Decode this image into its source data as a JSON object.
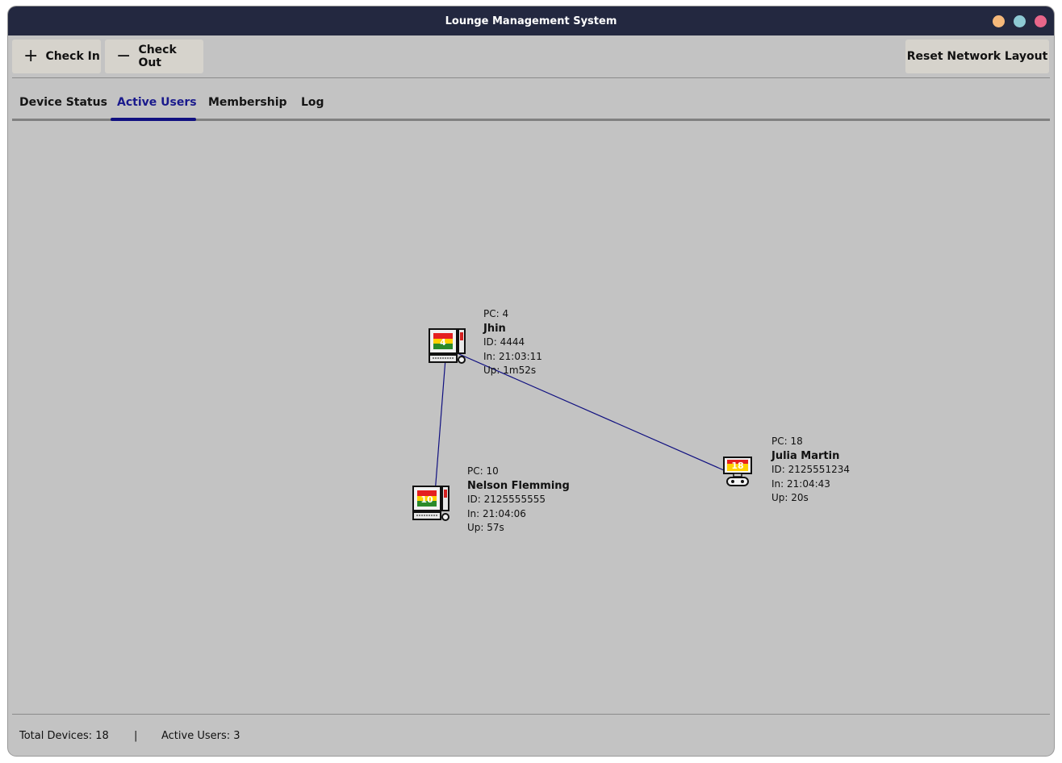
{
  "window": {
    "title": "Lounge Management System"
  },
  "toolbar": {
    "check_in": {
      "icon": "plus-icon",
      "label": "Check In"
    },
    "check_out": {
      "icon": "minus-icon",
      "label": "Check Out"
    },
    "reset_label": "Reset Network Layout"
  },
  "tabs": [
    {
      "label": "Device Status",
      "active": false
    },
    {
      "label": "Active Users",
      "active": true
    },
    {
      "label": "Membership",
      "active": false
    },
    {
      "label": "Log",
      "active": false
    }
  ],
  "accent_color": "#101080",
  "network": {
    "nodes": [
      {
        "pc_label": "PC: 4",
        "pc_number": "4",
        "device": "desktop-pc-icon",
        "name": "Jhin",
        "id_line": "ID: 4444",
        "in_line": "In: 21:03:11",
        "up_line": "Up: 1m52s"
      },
      {
        "pc_label": "PC: 10",
        "pc_number": "10",
        "device": "desktop-pc-icon",
        "name": "Nelson Flemming",
        "id_line": "ID: 2125555555",
        "in_line": "In: 21:04:06",
        "up_line": "Up: 57s"
      },
      {
        "pc_label": "PC: 18",
        "pc_number": "18",
        "device": "game-console-icon",
        "name": "Julia Martin",
        "id_line": "ID: 2125551234",
        "in_line": "In: 21:04:43",
        "up_line": "Up: 20s"
      }
    ],
    "links": [
      {
        "from": "PC: 4",
        "to": "PC: 10"
      },
      {
        "from": "PC: 4",
        "to": "PC: 18"
      }
    ]
  },
  "status": {
    "total_devices": "Total Devices: 18",
    "separator": "|",
    "active_users": "Active Users: 3"
  }
}
